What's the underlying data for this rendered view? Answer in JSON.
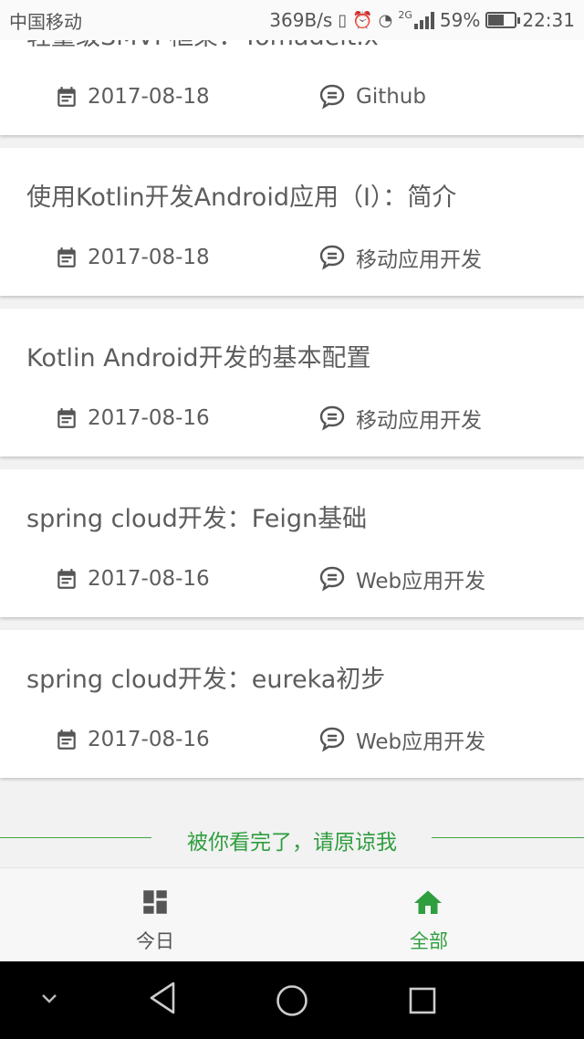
{
  "status": {
    "carrier": "中国移动",
    "speed": "369B/s",
    "network": "2G",
    "battery_percent": "59%",
    "battery_level": 0.59,
    "time": "22:31"
  },
  "articles": [
    {
      "title": "轻量级SMVP框架：Yomadeit.x",
      "date": "2017-08-18",
      "category": "Github"
    },
    {
      "title": "使用Kotlin开发Android应用（Ⅰ）：简介",
      "date": "2017-08-18",
      "category": "移动应用开发"
    },
    {
      "title": "Kotlin Android开发的基本配置",
      "date": "2017-08-16",
      "category": "移动应用开发"
    },
    {
      "title": "spring cloud开发：Feign基础",
      "date": "2017-08-16",
      "category": "Web应用开发"
    },
    {
      "title": "spring cloud开发：eureka初步",
      "date": "2017-08-16",
      "category": "Web应用开发"
    }
  ],
  "end_message": "被你看完了，请原谅我",
  "bottom_nav": {
    "today": "今日",
    "all": "全部"
  },
  "colors": {
    "accent": "#2f9e3f",
    "inactive": "#555555"
  }
}
